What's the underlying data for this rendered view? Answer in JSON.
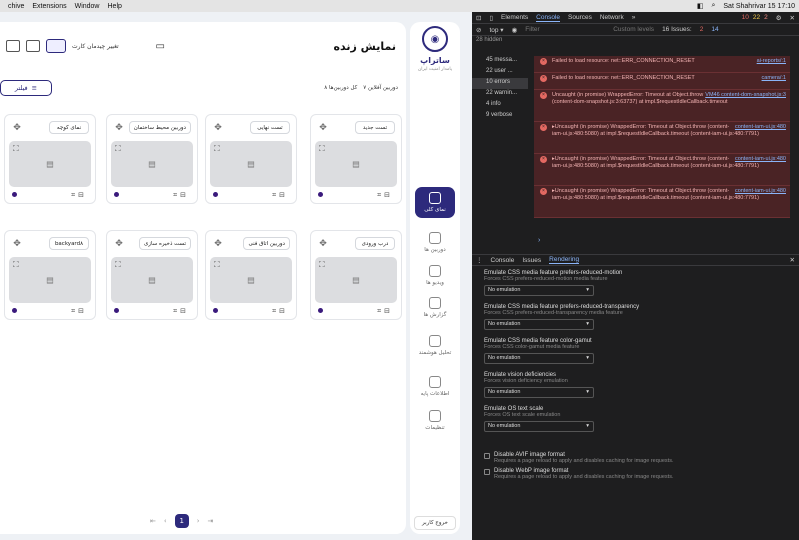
{
  "menubar": {
    "items": [
      "chive",
      "Extensions",
      "Window",
      "Help"
    ],
    "clock": "Sat Shahrivar 15  17:10"
  },
  "app": {
    "title": "نمایش زنده",
    "layout_label": "تغییر چیدمان کارت",
    "filter_label": "فیلتر",
    "summary_total": "۸ کل دوربین‌ها",
    "summary_online": "۷ دوربین آفلاین",
    "logo_name": "ساتراپ",
    "logo_sub": "پامدار امنیت ایران",
    "logout": "خروج کاربر",
    "page": "1"
  },
  "nav": [
    {
      "label": "نمای کلی",
      "active": true
    },
    {
      "label": "دوربین ها"
    },
    {
      "label": "ویدیو ها"
    },
    {
      "label": "گزارش ها"
    },
    {
      "label": "تحلیل هوشمند"
    },
    {
      "label": "اطلاعات پایه"
    },
    {
      "label": "تنظیمات"
    }
  ],
  "cards": [
    {
      "title": "تست جدید"
    },
    {
      "title": "تست نهایی"
    },
    {
      "title": "دوربین محیط ساختمان"
    },
    {
      "title": "نمای کوچه"
    },
    {
      "title": "درب ورودی"
    },
    {
      "title": "دوربین اتاق فنی"
    },
    {
      "title": "تست ذخیره سازی"
    },
    {
      "title": "backyard۸"
    }
  ],
  "devtools": {
    "tabs": [
      "Elements",
      "Console",
      "Sources",
      "Network"
    ],
    "counts": {
      "errors": "10",
      "warnings": "22",
      "info": "2"
    },
    "filter_placeholder": "Filter",
    "levels": "Custom levels",
    "issues": "16 Issues:",
    "issues_err": "2",
    "issues_info": "14",
    "hidden": "28 hidden",
    "sidebar": [
      "45 messa...",
      "22 user ...",
      "10 errors",
      "22 warnin...",
      "4 info",
      "9 verbose"
    ],
    "messages": [
      {
        "text": "Failed to load resource: net::ERR_CONNECTION_RESET",
        "src": "ai-reports/:1"
      },
      {
        "text": "Failed to load resource: net::ERR_CONNECTION_RESET",
        "src": "camera/:1"
      },
      {
        "text": "Uncaught (in promise) WrappedError: Timeout  at Object.throw (content-dom-snapshot.js:3:63737)  at impl.$requestIdleCallback.timeout",
        "src": "VM46 content-dom-snapshot.js:3"
      },
      {
        "text": "▸Uncaught (in promise) WrappedError: Timeout  at Object.throw (content-iam-ui.js:480:5080)  at impl.$requestIdleCallback.timeout (content-iam-ui.js:480:7791)",
        "src": "content-iam-ui.js:480"
      },
      {
        "text": "▸Uncaught (in promise) WrappedError: Timeout  at Object.throw (content-iam-ui.js:480:5080)  at impl.$requestIdleCallback.timeout (content-iam-ui.js:480:7791)",
        "src": "content-iam-ui.js:480"
      },
      {
        "text": "▸Uncaught (in promise) WrappedError: Timeout  at Object.throw (content-iam-ui.js:480:5080)  at impl.$requestIdleCallback.timeout (content-iam-ui.js:480:7791)",
        "src": "content-iam-ui.js:480"
      }
    ],
    "drawer_tabs": [
      "Console",
      "Issues",
      "Rendering"
    ],
    "rendering": [
      {
        "h": "Emulate CSS media feature prefers-reduced-motion",
        "s": "Forces CSS prefers-reduced-motion media feature",
        "v": "No emulation"
      },
      {
        "h": "Emulate CSS media feature prefers-reduced-transparency",
        "s": "Forces CSS prefers-reduced-transparency media feature",
        "v": "No emulation"
      },
      {
        "h": "Emulate CSS media feature color-gamut",
        "s": "Forces CSS color-gamut media feature",
        "v": "No emulation"
      },
      {
        "h": "Emulate vision deficiencies",
        "s": "Forces vision deficiency emulation",
        "v": "No emulation"
      },
      {
        "h": "Emulate OS text scale",
        "s": "Forces OS text scale emulation",
        "v": "No emulation"
      }
    ],
    "checks": [
      {
        "h": "Disable AVIF image format",
        "s": "Requires a page reload to apply and disables caching for image requests."
      },
      {
        "h": "Disable WebP image format",
        "s": "Requires a page reload to apply and disables caching for image requests."
      }
    ]
  }
}
